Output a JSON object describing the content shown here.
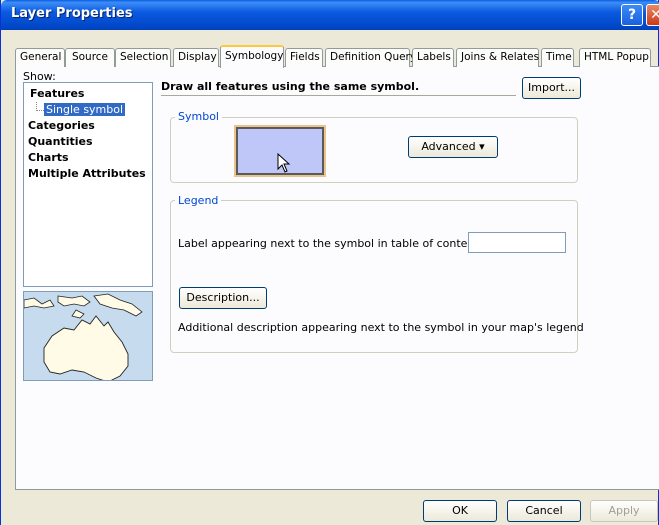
{
  "window": {
    "title": "Layer Properties",
    "help_label": "?",
    "close_label": "✕"
  },
  "tabs": [
    {
      "label": "General"
    },
    {
      "label": "Source"
    },
    {
      "label": "Selection"
    },
    {
      "label": "Display"
    },
    {
      "label": "Symbology",
      "active": true
    },
    {
      "label": "Fields"
    },
    {
      "label": "Definition Query"
    },
    {
      "label": "Labels"
    },
    {
      "label": "Joins & Relates"
    },
    {
      "label": "Time"
    },
    {
      "label": "HTML Popup"
    }
  ],
  "show": {
    "label": "Show:",
    "tree": {
      "features": "Features",
      "single_symbol": "Single symbol",
      "categories": "Categories",
      "quantities": "Quantities",
      "charts": "Charts",
      "multiple_attributes": "Multiple Attributes"
    }
  },
  "main": {
    "heading": "Draw all features using the same symbol.",
    "import_label": "Import...",
    "symbol_group": {
      "title": "Symbol",
      "advanced_label": "Advanced",
      "advanced_arrow": "▾",
      "swatch_color": "#bec7f7"
    },
    "legend_group": {
      "title": "Legend",
      "label_text": "Label appearing next to the symbol in table of contents:",
      "label_value": "",
      "description_button": "Description...",
      "description_text": "Additional description appearing next to the symbol in your map's legend"
    }
  },
  "footer": {
    "ok": "OK",
    "cancel": "Cancel",
    "apply": "Apply"
  },
  "colors": {
    "titlebar": "#0047c7",
    "selection": "#316ac5",
    "group_title": "#0046d5",
    "tab_highlight": "#ffc83c"
  }
}
